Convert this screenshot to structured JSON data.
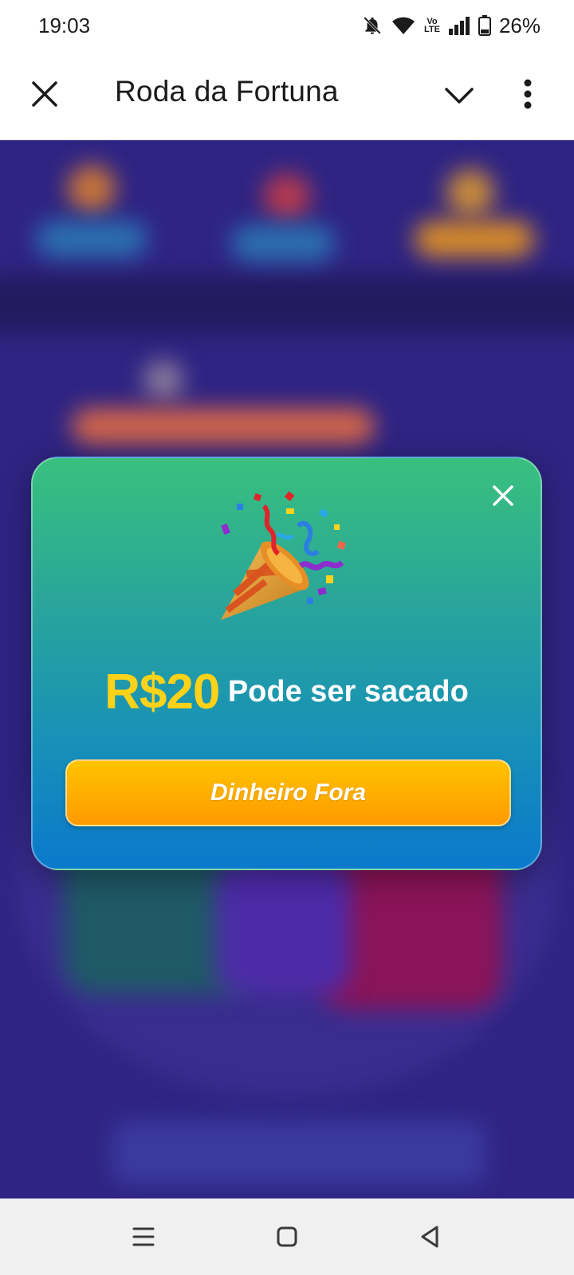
{
  "status_bar": {
    "time": "19:03",
    "battery": "26%",
    "icons": [
      "bell-off-icon",
      "wifi-icon",
      "volte-icon",
      "signal-icon",
      "battery-icon"
    ],
    "volte_top": "Vo",
    "volte_bottom": "LTE"
  },
  "app_bar": {
    "title": "Roda da Fortuna",
    "icons": [
      "close-icon",
      "chevron-down-icon",
      "more-vert-icon"
    ]
  },
  "popup": {
    "amount": "R$20",
    "reward_text": "Pode ser sacado",
    "button_label": "Dinheiro Fora",
    "icons": [
      "close-icon",
      "party-popper-icon"
    ],
    "colors": {
      "gradient_top": "#39c07e",
      "gradient_bottom": "#0b79cc",
      "amount": "#ffd21a",
      "button_top": "#ffc400",
      "button_bottom": "#ff9a00"
    }
  },
  "background": {
    "color": "#2e2380"
  },
  "nav_bar": {
    "icons": [
      "recents-icon",
      "home-icon",
      "back-icon"
    ]
  }
}
